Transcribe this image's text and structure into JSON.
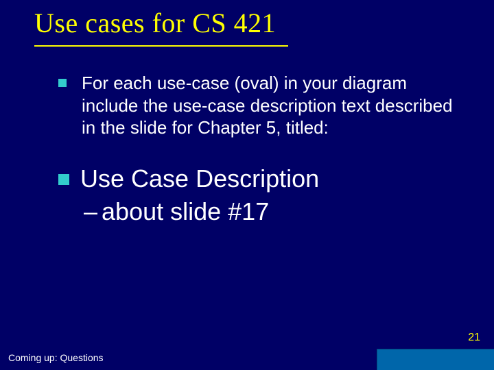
{
  "title": "Use cases for CS 421",
  "bullet1": "For each use-case (oval) in your diagram include the use-case description text described in the slide for Chapter 5, titled:",
  "bullet2": "Use Case Description",
  "sub_dash": "–",
  "sub_text": "about slide #17",
  "page_number": "21",
  "coming_up": "Coming up: Questions"
}
